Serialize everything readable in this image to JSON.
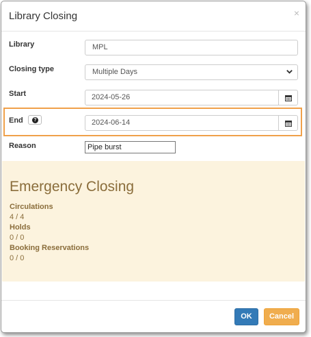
{
  "dialog": {
    "title": "Library Closing",
    "close_symbol": "×"
  },
  "form": {
    "library": {
      "label": "Library",
      "value": "MPL"
    },
    "closing_type": {
      "label": "Closing type",
      "value": "Multiple Days"
    },
    "start": {
      "label": "Start",
      "value": "2024-05-26"
    },
    "end": {
      "label": "End",
      "value": "2024-06-14"
    },
    "reason": {
      "label": "Reason",
      "value": "Pipe burst"
    }
  },
  "emergency": {
    "title": "Emergency Closing",
    "circulations_label": "Circulations",
    "circulations_value": "4 / 4",
    "holds_label": "Holds",
    "holds_value": "0 / 0",
    "booking_label": "Booking Reservations",
    "booking_value": "0 / 0"
  },
  "footer": {
    "ok_label": "OK",
    "cancel_label": "Cancel"
  },
  "colors": {
    "highlight": "#f0a049",
    "emergency_bg": "#fcf3de",
    "emergency_text": "#8a6d3b",
    "ok_bg": "#337ab7",
    "cancel_bg": "#f0ad4e"
  },
  "icons": {
    "calendar": "calendar-icon",
    "help": "question-circle-icon",
    "close": "close-icon",
    "chevron": "chevron-down-icon"
  }
}
